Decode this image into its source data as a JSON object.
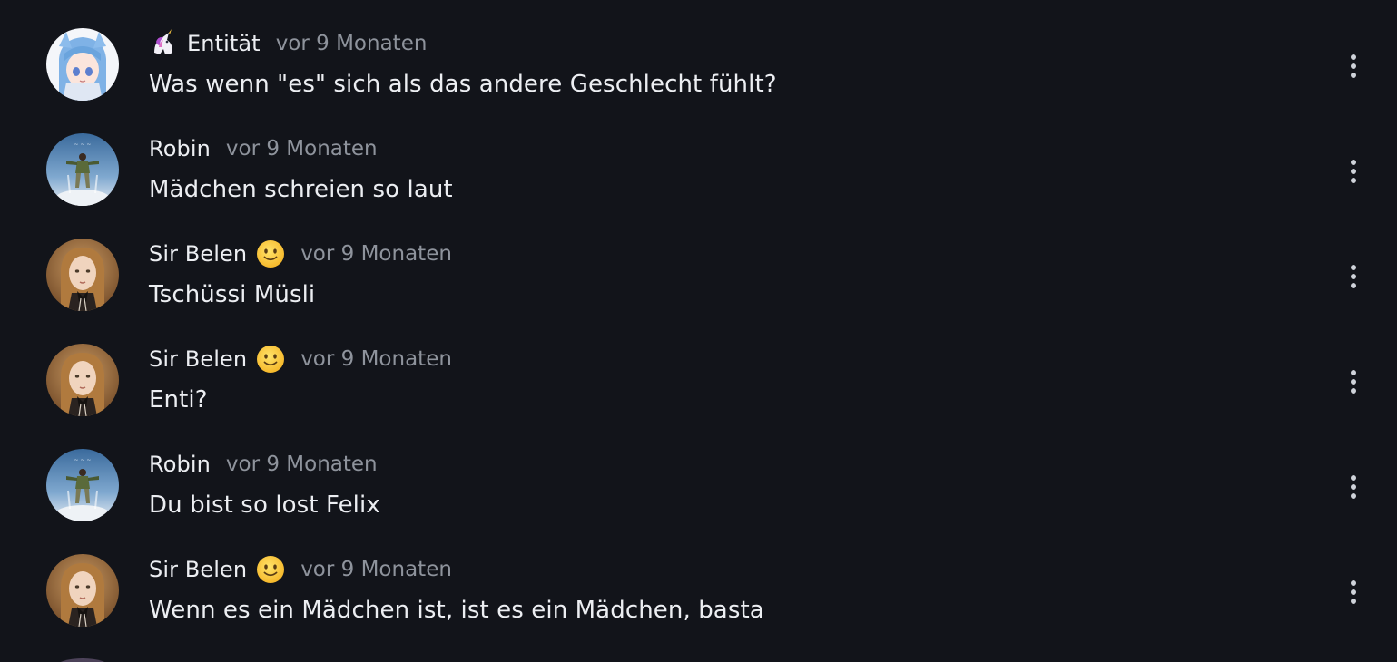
{
  "comments": [
    {
      "author": "Entität",
      "author_prefix_icon": "unicorn-emoji",
      "time": "vor 9 Monaten",
      "text": "Was wenn \"es\" sich als das andere Geschlecht fühlt?",
      "avatar": "anime-girl-avatar"
    },
    {
      "author": "Robin",
      "time": "vor 9 Monaten",
      "text": "Mädchen schreien so laut",
      "avatar": "movie-poster-avatar"
    },
    {
      "author": "Sir Belen",
      "author_suffix_icon": "slightly-smiling-face-emoji",
      "time": "vor 9 Monaten",
      "text": "Tschüssi Müsli",
      "avatar": "doll-portrait-avatar"
    },
    {
      "author": "Sir Belen",
      "author_suffix_icon": "slightly-smiling-face-emoji",
      "time": "vor 9 Monaten",
      "text": "Enti?",
      "avatar": "doll-portrait-avatar"
    },
    {
      "author": "Robin",
      "time": "vor 9 Monaten",
      "text": "Du bist so lost Felix",
      "avatar": "movie-poster-avatar"
    },
    {
      "author": "Sir Belen",
      "author_suffix_icon": "slightly-smiling-face-emoji",
      "time": "vor 9 Monaten",
      "text": "Wenn es ein Mädchen ist, ist es ein Mädchen, basta",
      "avatar": "doll-portrait-avatar"
    }
  ],
  "menu_icon": "more-vertical-icon",
  "colors": {
    "background": "#12141a",
    "text": "#eceef2",
    "muted": "#8e939c"
  }
}
